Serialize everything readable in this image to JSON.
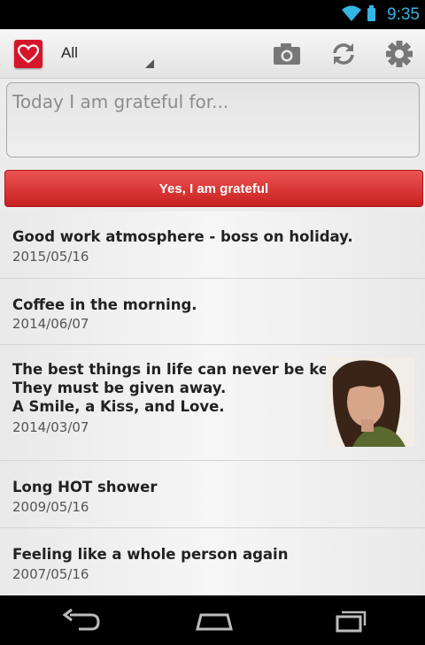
{
  "status_bar": {
    "time": "9:35",
    "icons": [
      "wifi-icon",
      "battery-icon"
    ],
    "accent": "#33b5e5"
  },
  "action_bar": {
    "icon": "heart-icon",
    "filter_selected": "All",
    "actions": [
      "camera-icon",
      "sync-icon",
      "gear-icon"
    ]
  },
  "input": {
    "placeholder": "Today I am grateful for...",
    "value": ""
  },
  "submit_button": {
    "label": "Yes, I am grateful",
    "color": "#d62e2e"
  },
  "entries": [
    {
      "text": "Good work atmosphere - boss on holiday.",
      "date": "2015/05/16"
    },
    {
      "text": "Coffee in the morning.",
      "date": "2014/06/07"
    },
    {
      "text": "The best things in life can never be kept;\nThey must be given away.\nA Smile, a Kiss, and Love.",
      "date": "2014/03/07",
      "photo": "woman-portrait-photo"
    },
    {
      "text": "Long HOT shower",
      "date": "2009/05/16"
    },
    {
      "text": "Feeling like a whole person again",
      "date": "2007/05/16"
    }
  ],
  "nav_bar": {
    "buttons": [
      "back-icon",
      "home-icon",
      "recent-apps-icon"
    ]
  }
}
